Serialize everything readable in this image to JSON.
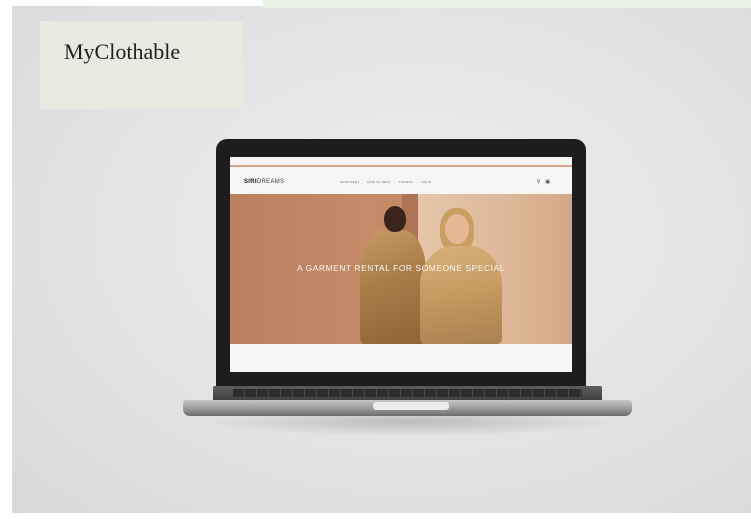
{
  "brand": {
    "name": "MyClothable"
  },
  "laptop_site": {
    "logo_bold": "SIRI",
    "logo_rest": "DREAMS",
    "menu": [
      "SHOP RENT",
      "HOW TO RENT",
      "TICKETS",
      "LOGIN"
    ],
    "icons": [
      "search-icon",
      "bag-icon"
    ],
    "hero_title": "A GARMENT RENTAL FOR SOMEONE SPECIAL"
  },
  "colors": {
    "accent_line": "#d7a58c",
    "hero_warm": "#c68d6a",
    "brand_card": "#e9e8e1"
  }
}
